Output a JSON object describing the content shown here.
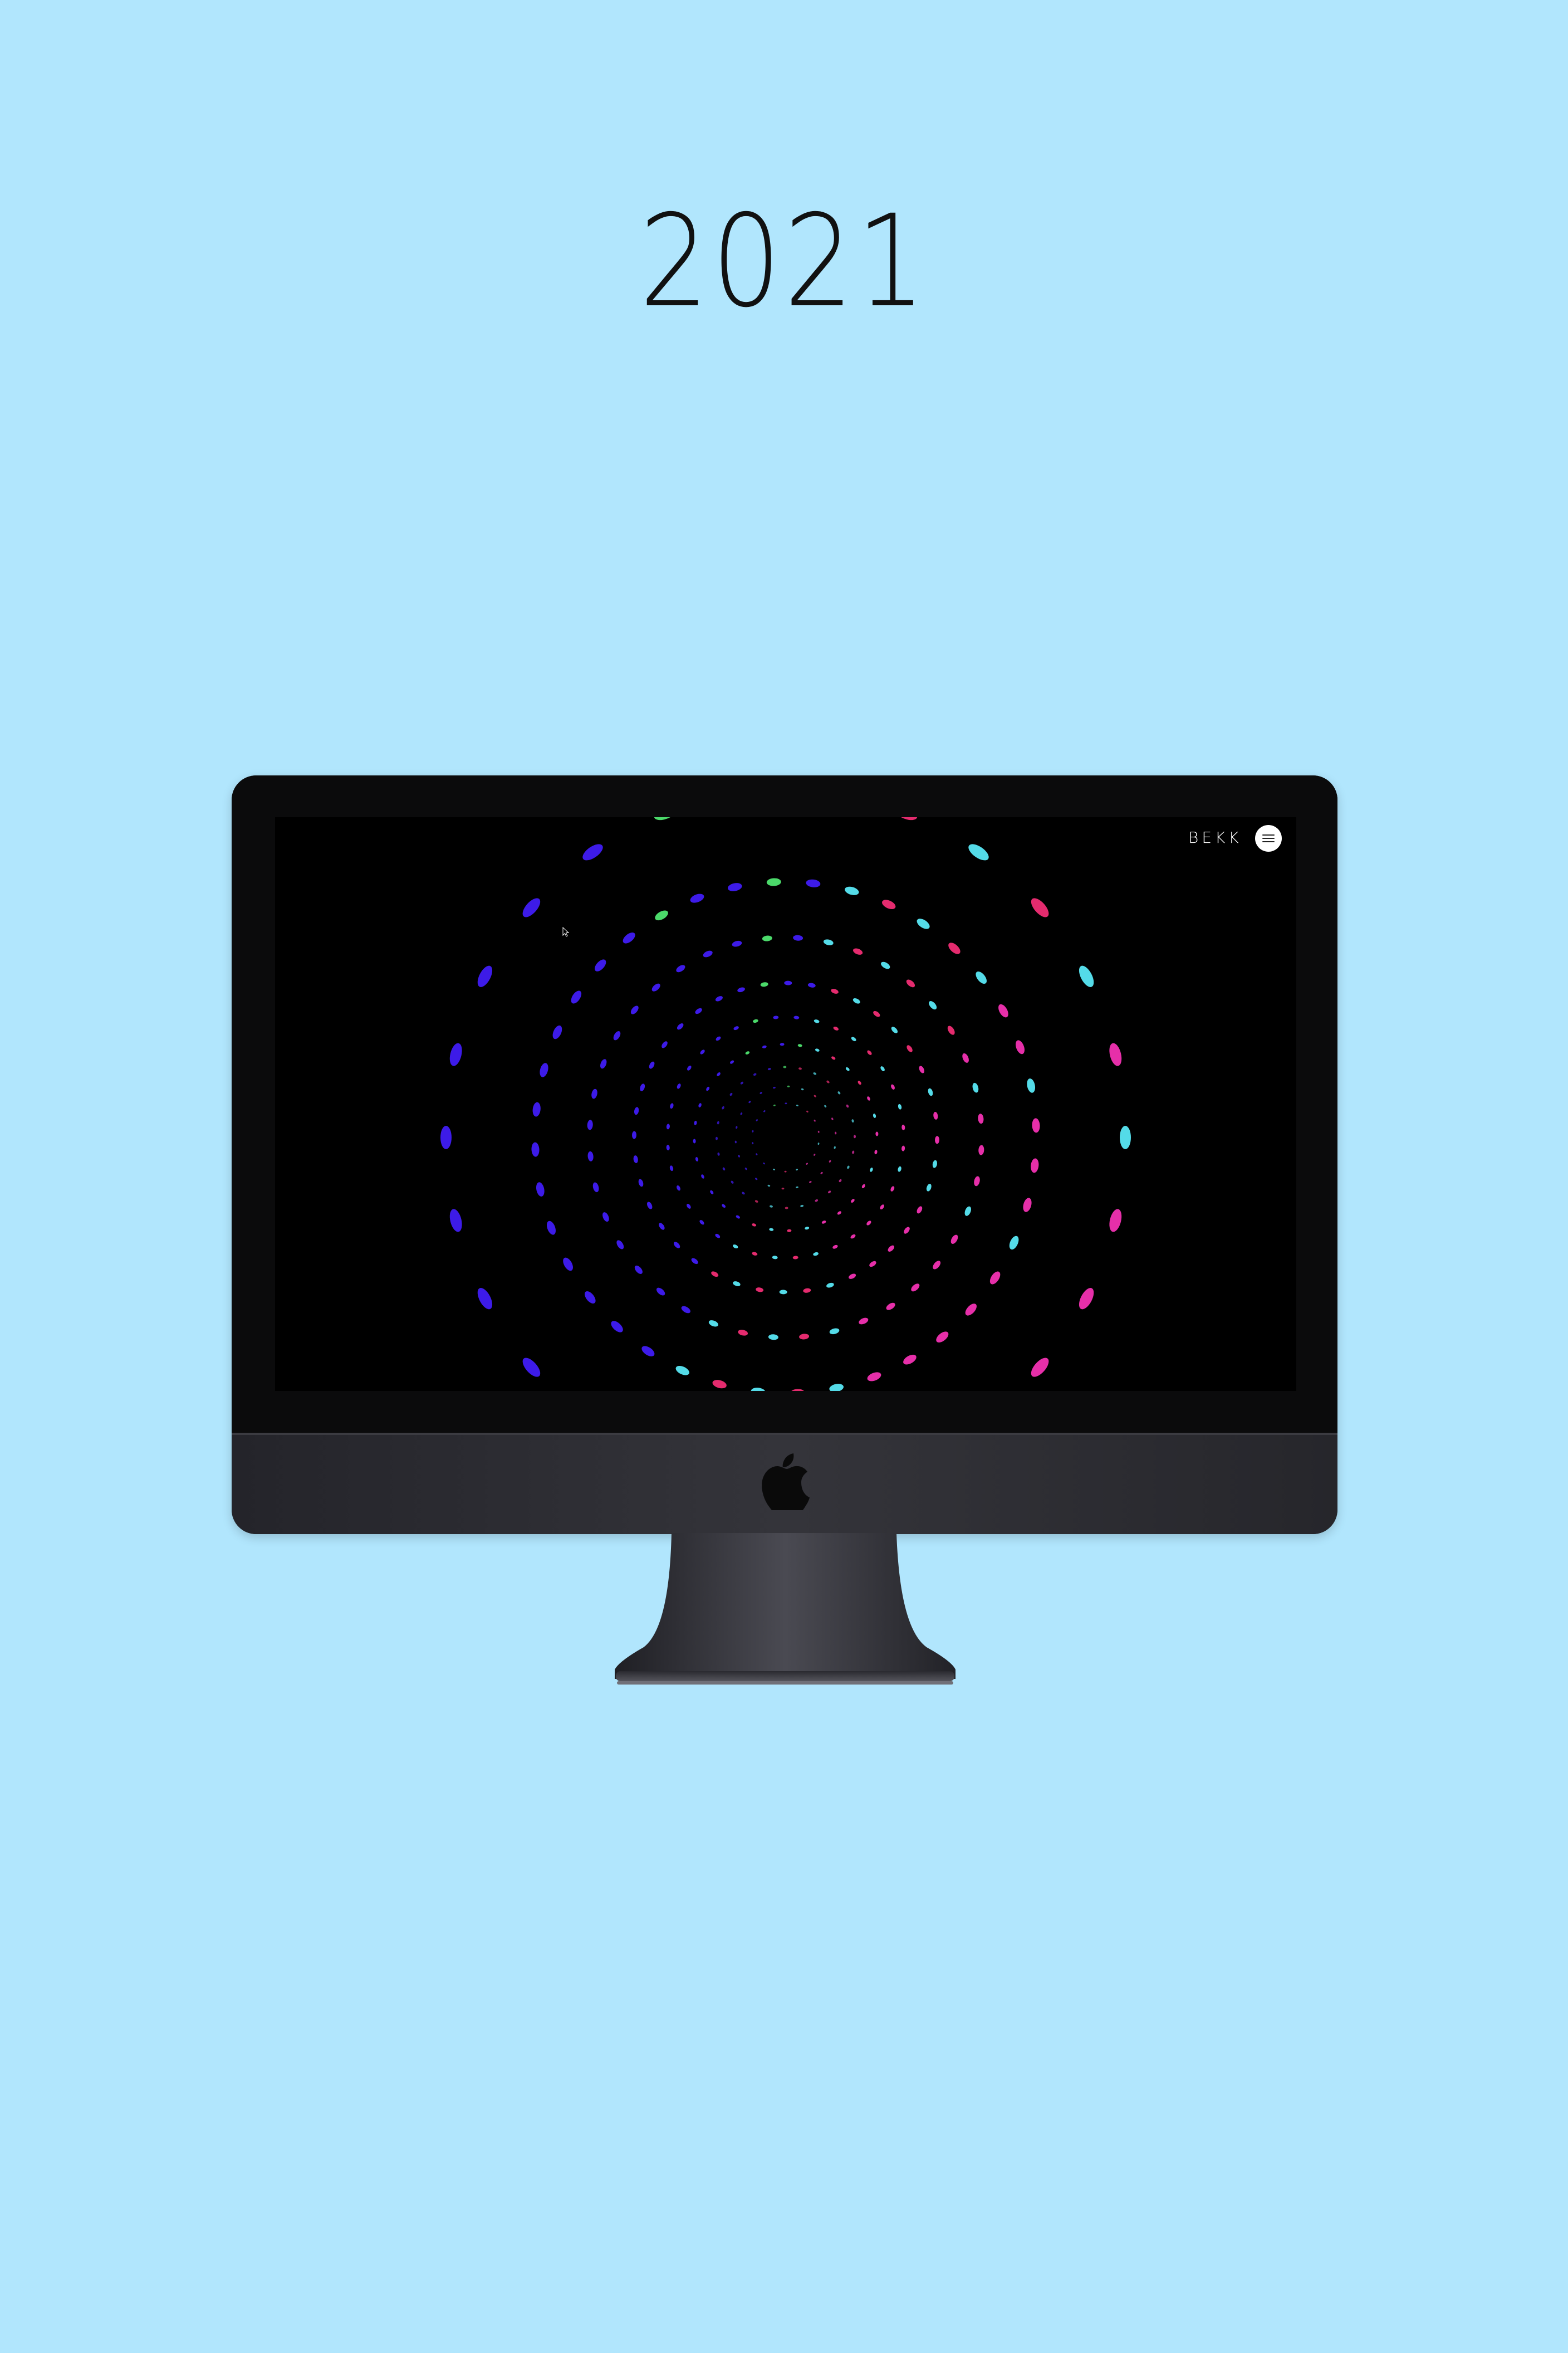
{
  "page": {
    "heading": "2021",
    "background": "#b1e6fd"
  },
  "website": {
    "brand": "BEKK",
    "menu_icon": "hamburger-menu-icon",
    "background": "#000000"
  },
  "device": {
    "logo_icon": "apple-logo-icon"
  },
  "palette": {
    "blue": "#3d1be8",
    "cyan": "#54dbe8",
    "pink": "#e62fa9",
    "rose": "#e42b6e",
    "green": "#4bd96a",
    "violet": "#6a2fd8"
  }
}
